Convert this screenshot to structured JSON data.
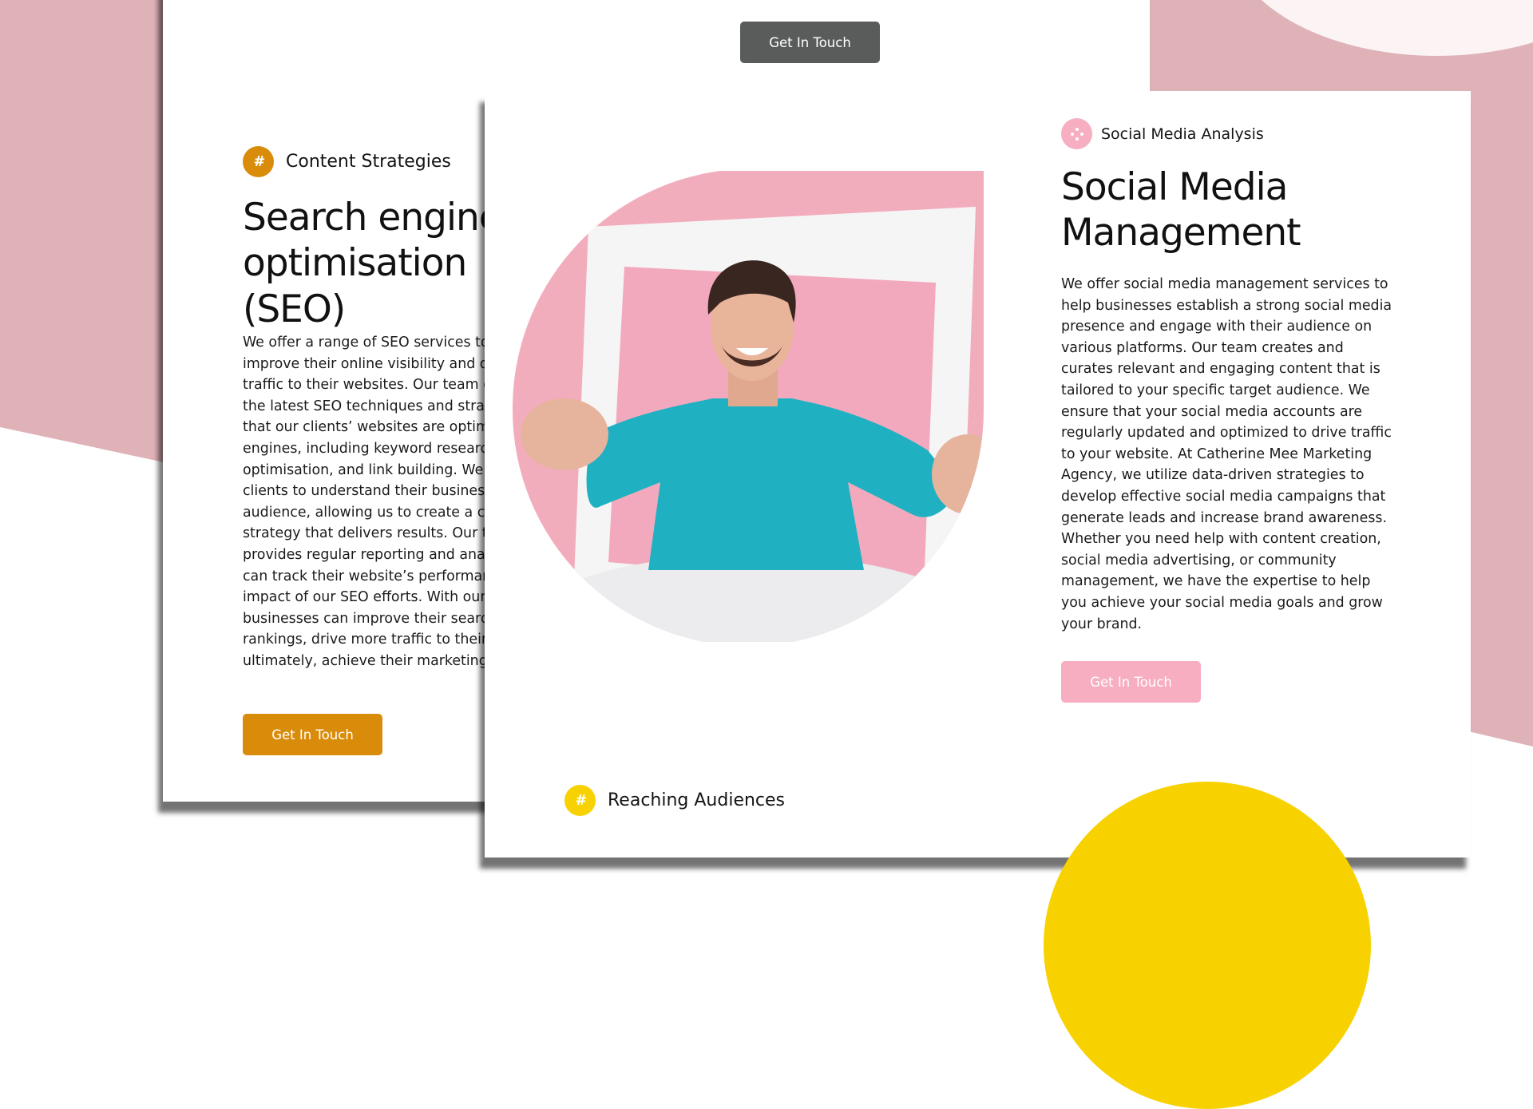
{
  "colors": {
    "accent_pink_bg": "#dfb2b8",
    "seo_orange": "#d98c0a",
    "social_pink": "#f7aec0",
    "top_button_gray": "#5a5c5c",
    "audience_yellow": "#f7d200"
  },
  "top_button": {
    "label": "Get In Touch"
  },
  "seo_card": {
    "tag_icon": "hashtag-icon",
    "tag_label": "Content Strategies",
    "heading_lines": [
      "Search engine",
      "optimisation",
      "(SEO)"
    ],
    "body_lines": [
      "We offer a range of SEO services to h",
      "improve their online visibility and driv",
      "traffic to their websites. Our team of e",
      "the latest SEO techniques and strateg",
      "that our clients’ websites are optimise",
      "engines, including keyword research, o",
      "optimisation, and link building. We wo",
      "clients to understand their business a",
      "audience, allowing us to create a cust",
      "strategy that delivers results. Our tear",
      "provides regular reporting and analys",
      "can track their website’s performance",
      "impact of our SEO efforts. With our SE",
      "businesses can improve their search",
      "rankings, drive more traffic to their we",
      "ultimately, achieve their marketing go"
    ],
    "button_label": "Get In Touch"
  },
  "social_card": {
    "tag_icon": "dots-icon",
    "tag_label": "Social Media Analysis",
    "heading_lines": [
      "Social Media",
      "Management"
    ],
    "body_lines": [
      "We offer social media management services to",
      "help businesses establish a strong social media",
      "presence and engage with their audience on",
      "various platforms. Our team creates and",
      "curates relevant and engaging content that is",
      "tailored to your specific target audience. We",
      "ensure that your social media accounts are",
      "regularly updated and optimized to drive traffic",
      "to your website. At Catherine Mee Marketing",
      "Agency, we utilize data-driven strategies to",
      "develop effective social media campaigns that",
      "generate leads and increase brand awareness.",
      "Whether you need help with content creation,",
      "social media advertising, or community",
      "management, we have the expertise to help",
      "you achieve your social media goals and grow",
      "your brand."
    ],
    "button_label": "Get In Touch",
    "image_icon": "smiling-man-photo-icon"
  },
  "audience_section": {
    "tag_icon": "hashtag-icon",
    "tag_label": "Reaching Audiences"
  }
}
